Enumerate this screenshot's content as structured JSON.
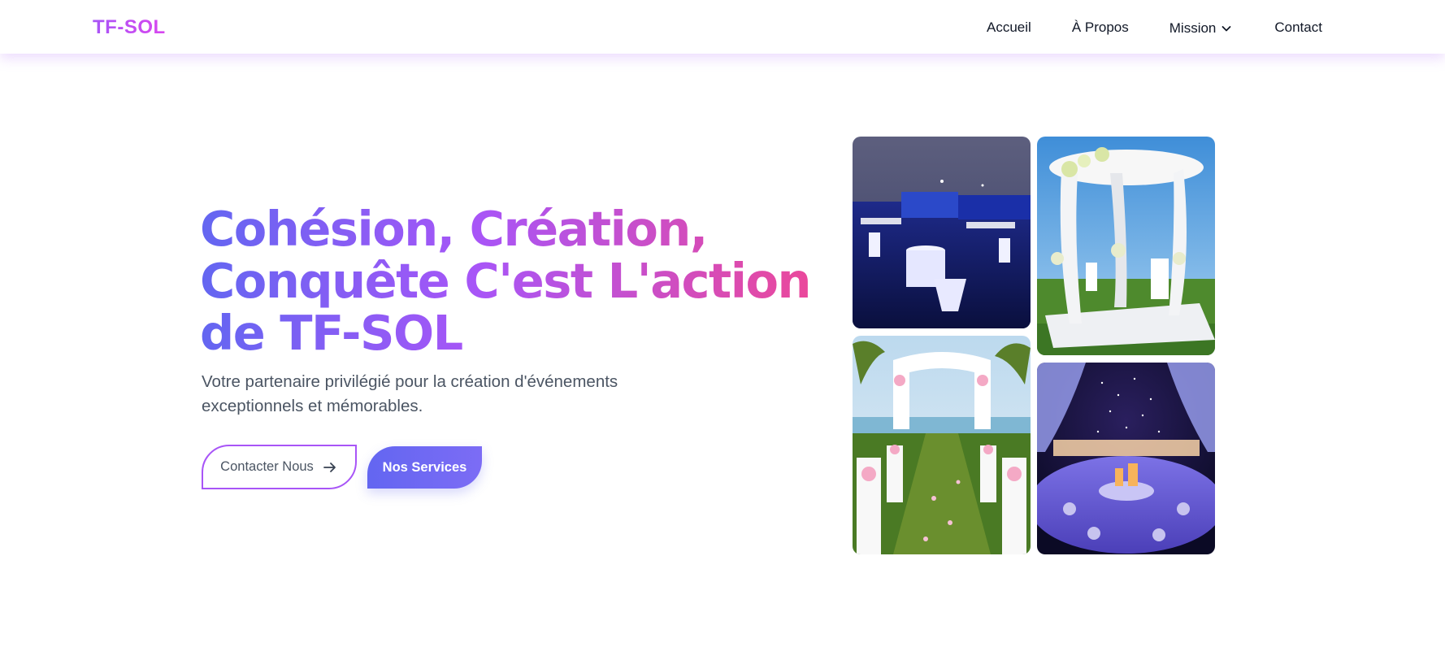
{
  "brand": {
    "name": "TF-SOL"
  },
  "nav": {
    "items": [
      {
        "label": "Accueil"
      },
      {
        "label": "À Propos"
      },
      {
        "label": "Mission"
      },
      {
        "label": "Contact"
      }
    ]
  },
  "hero": {
    "title": "Cohésion, Création, Conquête C'est L'action de TF-SOL",
    "subtitle": "Votre partenaire privilégié pour la création d'événements exceptionnels et mémorables.",
    "primary_button": "Contacter Nous",
    "secondary_button": "Nos Services"
  },
  "images": [
    {
      "icon": "night-event-photo"
    },
    {
      "icon": "white-gazebo-photo"
    },
    {
      "icon": "beach-wedding-aisle-photo"
    },
    {
      "icon": "purple-banquet-photo"
    }
  ],
  "colors": {
    "accent_purple": "#a855f7",
    "accent_indigo": "#6366f1",
    "accent_pink": "#ec4899",
    "nav_shadow": "#e9d5ff"
  }
}
